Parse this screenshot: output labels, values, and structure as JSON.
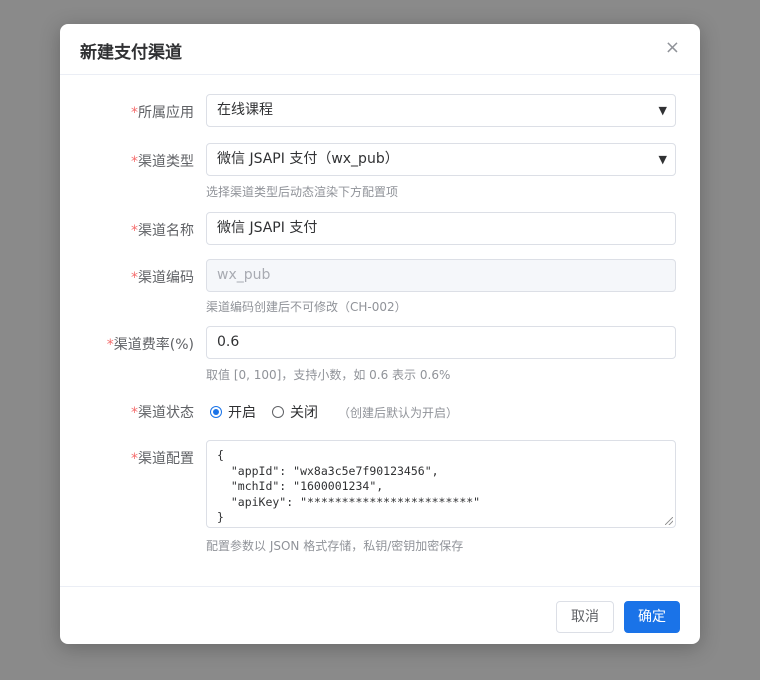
{
  "dialog": {
    "title": "新建支付渠道",
    "close_icon": "×"
  },
  "form": {
    "required_mark": "*",
    "app": {
      "label": "所属应用",
      "value": "在线课程"
    },
    "channel_type": {
      "label": "渠道类型",
      "value": "微信 JSAPI 支付（wx_pub）",
      "hint": "选择渠道类型后动态渲染下方配置项"
    },
    "channel_name": {
      "label": "渠道名称",
      "value": "微信 JSAPI 支付"
    },
    "channel_code": {
      "label": "渠道编码",
      "value": "wx_pub",
      "hint": "渠道编码创建后不可修改（CH-002）"
    },
    "fee_rate": {
      "label": "渠道费率(%)",
      "value": "0.6",
      "hint": "取值 [0, 100]，支持小数，如 0.6 表示 0.6%"
    },
    "status": {
      "label": "渠道状态",
      "options": [
        "开启",
        "关闭"
      ],
      "selected": "开启",
      "note": "（创建后默认为开启）"
    },
    "config": {
      "label": "渠道配置",
      "value": "{\n  \"appId\": \"wx8a3c5e7f90123456\",\n  \"mchId\": \"1600001234\",\n  \"apiKey\": \"************************\"\n}",
      "hint": "配置参数以 JSON 格式存储，私钥/密钥加密保存"
    }
  },
  "footer": {
    "cancel_label": "取消",
    "ok_label": "确定"
  },
  "colors": {
    "primary": "#1a73e8",
    "required": "#f56c6c",
    "overlay": "#8a8a8a"
  }
}
